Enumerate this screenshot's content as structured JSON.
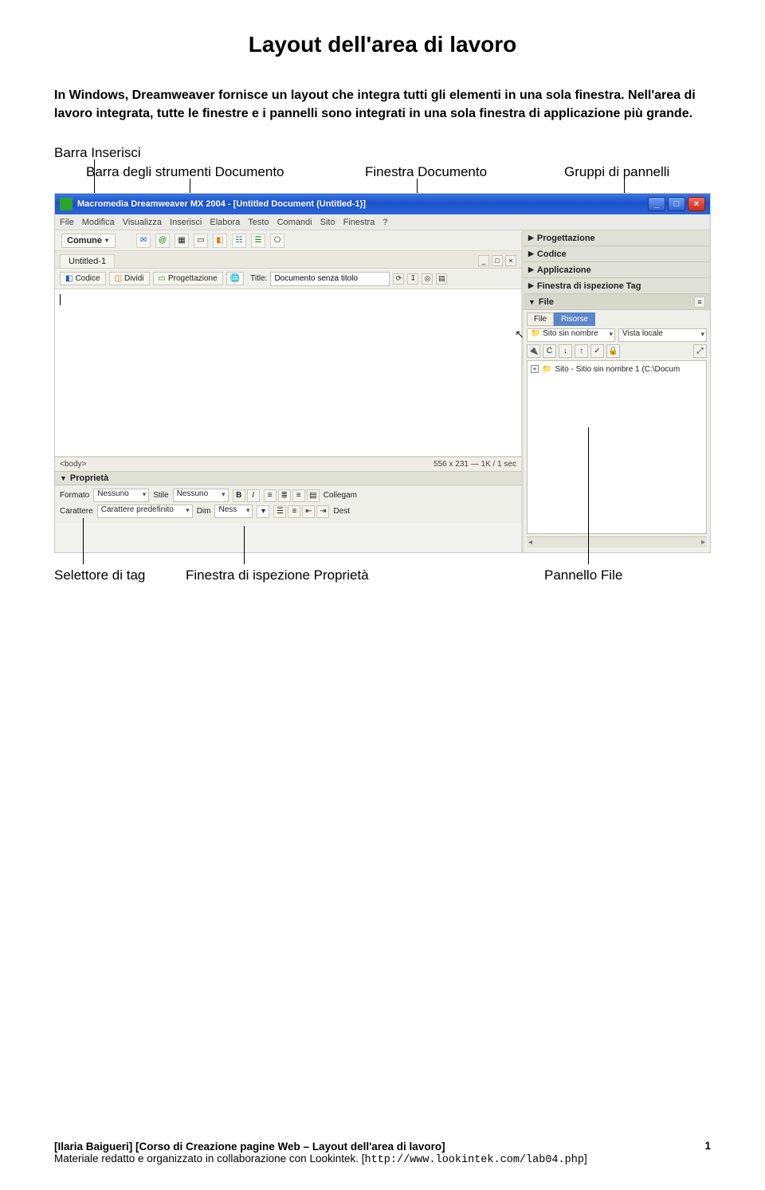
{
  "page": {
    "title": "Layout dell'area di lavoro",
    "intro": "In Windows, Dreamweaver fornisce un layout che integra tutti gli elementi in una sola finestra. Nell'area di lavoro integrata, tutte le finestre e i pannelli sono integrati in una sola finestra di applicazione più grande."
  },
  "callouts_top": {
    "barra_inserisci": "Barra Inserisci",
    "barra_doc": "Barra degli strumenti Documento",
    "finestra_doc": "Finestra Documento",
    "gruppi_pannelli": "Gruppi di pannelli"
  },
  "callouts_bottom": {
    "selettore_tag": "Selettore di tag",
    "ispezione_prop": "Finestra di ispezione Proprietà",
    "pannello_file": "Pannello File"
  },
  "app": {
    "title": "Macromedia Dreamweaver MX 2004 - [Untitled Document (Untitled-1)]",
    "menu": [
      "File",
      "Modifica",
      "Visualizza",
      "Inserisci",
      "Elabora",
      "Testo",
      "Comandi",
      "Sito",
      "Finestra",
      "?"
    ],
    "insert_tab": "Comune",
    "doc_tab": "Untitled-1",
    "toolbar": {
      "codice": "Codice",
      "dividi": "Dividi",
      "progettazione": "Progettazione",
      "title_label": "Title:",
      "title_value": "Documento senza titolo"
    },
    "status": {
      "tag": "<body>",
      "dims": "556 x 231 — 1K / 1 sec"
    },
    "properties": {
      "panel_title": "Proprietà",
      "format_label": "Formato",
      "format_value": "Nessuno",
      "style_label": "Stile",
      "style_value": "Nessuno",
      "link_label": "Collegam",
      "font_label": "Carattere",
      "font_value": "Carattere predefinito",
      "dim_label": "Dim",
      "dim_value": "Ness",
      "dest_label": "Dest"
    },
    "panels": {
      "progettazione": "Progettazione",
      "codice": "Codice",
      "applicazione": "Applicazione",
      "ispezione_tag": "Finestra di ispezione Tag",
      "file": "File",
      "file_tabs": {
        "file": "File",
        "risorse": "Risorse"
      },
      "site_combo": "Sito sin nombre",
      "view_combo": "Vista locale",
      "tree_root": "Sito - Sitio sin nombre 1 (C:\\Docum"
    }
  },
  "footer": {
    "line1": "[Ilaria Baigueri] [Corso di Creazione pagine Web – Layout dell'area di lavoro]",
    "line2_a": "Materiale redatto e organizzato in collaborazione con Lookintek. [",
    "line2_url": "http://www.lookintek.com/lab04.php",
    "line2_b": "]",
    "page_number": "1"
  }
}
